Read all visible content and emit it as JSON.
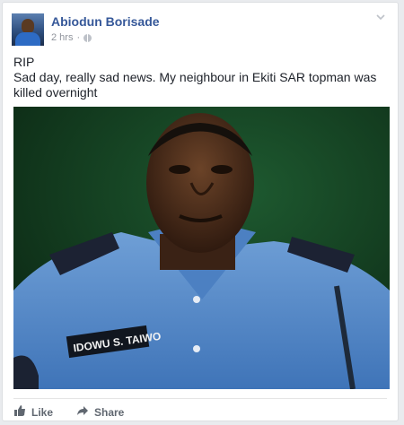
{
  "post": {
    "author": "Abiodun Borisade",
    "time": "2 hrs",
    "separator": "·",
    "text_lines": [
      "RIP",
      "Sad day, really sad news. My neighbour in Ekiti SAR topman was killed overnight"
    ],
    "photo": {
      "name_tag": "IDOWU S. TAIWO"
    }
  },
  "actions": {
    "like_label": "Like",
    "share_label": "Share"
  },
  "icons": {
    "privacy": "globe-icon",
    "menu": "chevron-down-icon",
    "like": "thumbs-up-icon",
    "share": "share-arrow-icon"
  },
  "colors": {
    "author": "#365899",
    "meta": "#90949c",
    "text": "#1d2129",
    "action": "#606770",
    "background": "#e9ebee"
  }
}
